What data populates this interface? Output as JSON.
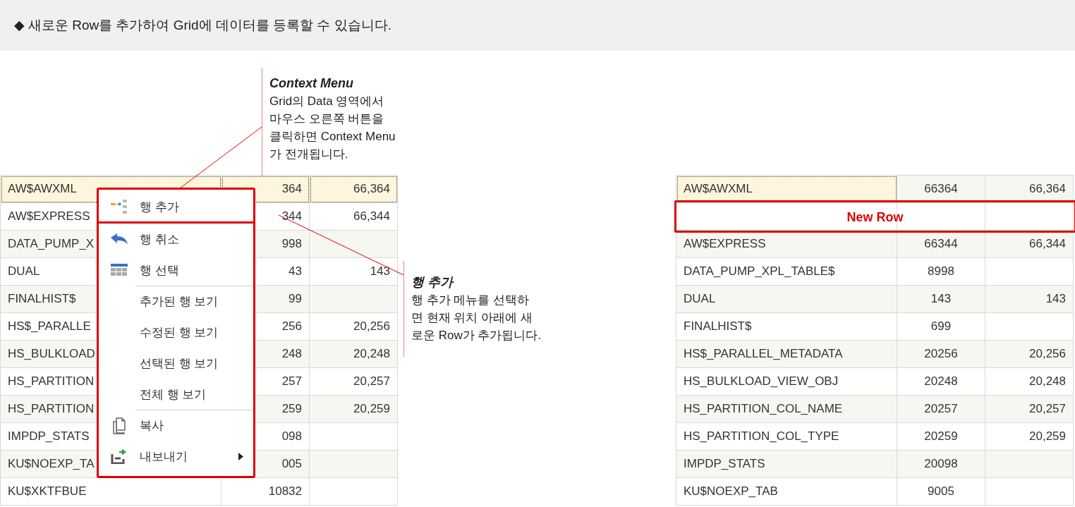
{
  "header": {
    "text": "◆ 새로운 Row를 추가하여 Grid에 데이터를 등록할 수 있습니다."
  },
  "before_grid": {
    "rows": [
      {
        "cells": [
          "AW$AWXML",
          "364",
          "66,364"
        ],
        "selected": true
      },
      {
        "cells": [
          "AW$EXPRESS",
          "344",
          "66,344"
        ],
        "selected": false
      },
      {
        "cells": [
          "DATA_PUMP_X",
          "998",
          ""
        ],
        "selected": false
      },
      {
        "cells": [
          "DUAL",
          "43",
          "143"
        ],
        "selected": false
      },
      {
        "cells": [
          "FINALHIST$",
          "99",
          ""
        ],
        "selected": false
      },
      {
        "cells": [
          "HS$_PARALLE",
          "256",
          "20,256"
        ],
        "selected": false
      },
      {
        "cells": [
          "HS_BULKLOAD",
          "248",
          "20,248"
        ],
        "selected": false
      },
      {
        "cells": [
          "HS_PARTITION",
          "257",
          "20,257"
        ],
        "selected": false
      },
      {
        "cells": [
          "HS_PARTITION",
          "259",
          "20,259"
        ],
        "selected": false
      },
      {
        "cells": [
          "IMPDP_STATS",
          "098",
          ""
        ],
        "selected": false
      },
      {
        "cells": [
          "KU$NOEXP_TA",
          "005",
          ""
        ],
        "selected": false
      },
      {
        "cells": [
          "KU$XKTFBUE",
          "10832",
          ""
        ],
        "selected": false
      }
    ]
  },
  "context_menu": {
    "items": [
      {
        "kind": "add",
        "label": "행 추가",
        "separator_before": false,
        "highlighted": true,
        "has_submenu": false
      },
      {
        "kind": "undo",
        "label": "행 취소",
        "separator_before": false,
        "highlighted": false,
        "has_submenu": false
      },
      {
        "kind": "select",
        "label": "행 선택",
        "separator_before": false,
        "highlighted": false,
        "has_submenu": false
      },
      {
        "kind": "view",
        "label": "추가된 행 보기",
        "separator_before": true,
        "highlighted": false,
        "has_submenu": false
      },
      {
        "kind": "view",
        "label": "수정된 행 보기",
        "separator_before": false,
        "highlighted": false,
        "has_submenu": false
      },
      {
        "kind": "view",
        "label": "선택된 행 보기",
        "separator_before": false,
        "highlighted": false,
        "has_submenu": false
      },
      {
        "kind": "view",
        "label": "전체 행 보기",
        "separator_before": false,
        "highlighted": false,
        "has_submenu": false
      },
      {
        "kind": "copy",
        "label": "복사",
        "separator_before": true,
        "highlighted": false,
        "has_submenu": false
      },
      {
        "kind": "export",
        "label": "내보내기",
        "separator_before": false,
        "highlighted": false,
        "has_submenu": true
      }
    ]
  },
  "callouts": [
    {
      "title": "Context Menu",
      "text": "Grid의 Data 영역에서\n마우스 오른쪽 버튼을\n클릭하면 Context Menu\n가 전개됩니다."
    },
    {
      "title": "행 추가",
      "text": "행 추가 메뉴를 선택하\n면 현재 위치 아래에 새\n로운 Row가 추가됩니다."
    }
  ],
  "after_grid": {
    "rows": [
      {
        "kind": "data",
        "cells": [
          "AW$AWXML",
          "66364",
          "66,364"
        ],
        "selected": true
      },
      {
        "kind": "new",
        "label": "New Row",
        "highlighted": true
      },
      {
        "kind": "data",
        "cells": [
          "AW$EXPRESS",
          "66344",
          "66,344"
        ],
        "selected": false
      },
      {
        "kind": "data",
        "cells": [
          "DATA_PUMP_XPL_TABLE$",
          "8998",
          ""
        ],
        "selected": false
      },
      {
        "kind": "data",
        "cells": [
          "DUAL",
          "143",
          "143"
        ],
        "selected": false
      },
      {
        "kind": "data",
        "cells": [
          "FINALHIST$",
          "699",
          ""
        ],
        "selected": false
      },
      {
        "kind": "data",
        "cells": [
          "HS$_PARALLEL_METADATA",
          "20256",
          "20,256"
        ],
        "selected": false
      },
      {
        "kind": "data",
        "cells": [
          "HS_BULKLOAD_VIEW_OBJ",
          "20248",
          "20,248"
        ],
        "selected": false
      },
      {
        "kind": "data",
        "cells": [
          "HS_PARTITION_COL_NAME",
          "20257",
          "20,257"
        ],
        "selected": false
      },
      {
        "kind": "data",
        "cells": [
          "HS_PARTITION_COL_TYPE",
          "20259",
          "20,259"
        ],
        "selected": false
      },
      {
        "kind": "data",
        "cells": [
          "IMPDP_STATS",
          "20098",
          ""
        ],
        "selected": false
      },
      {
        "kind": "data",
        "cells": [
          "KU$NOEXP_TAB",
          "9005",
          ""
        ],
        "selected": false
      }
    ]
  }
}
